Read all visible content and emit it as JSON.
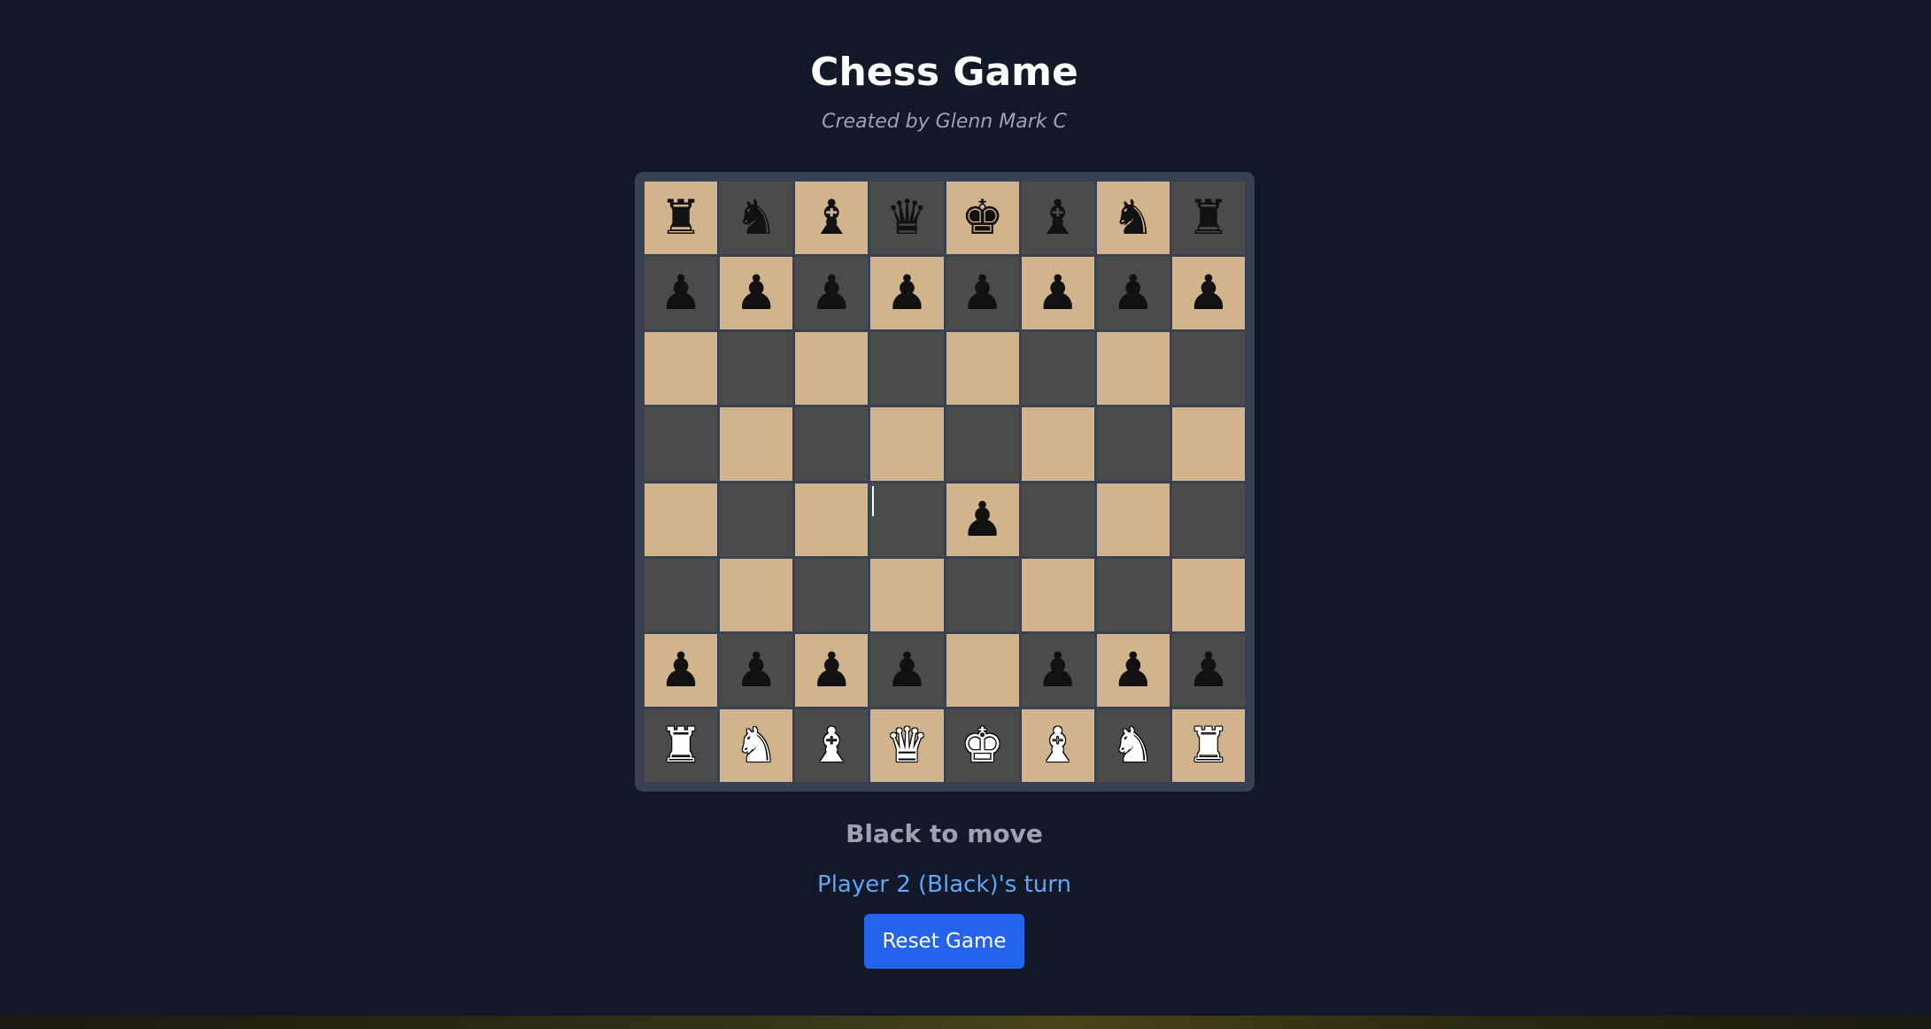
{
  "header": {
    "title": "Chess Game",
    "subtitle": "Created by Glenn Mark C"
  },
  "board": {
    "light_color": "#d2b48c",
    "dark_color": "#4b4b4b",
    "frame_color": "#374151",
    "rows": [
      [
        {
          "piece": "rook",
          "color": "black",
          "glyph": "♜"
        },
        {
          "piece": "knight",
          "color": "black",
          "glyph": "♞"
        },
        {
          "piece": "bishop",
          "color": "black",
          "glyph": "♝"
        },
        {
          "piece": "queen",
          "color": "black",
          "glyph": "♛"
        },
        {
          "piece": "king",
          "color": "black",
          "glyph": "♚"
        },
        {
          "piece": "bishop",
          "color": "black",
          "glyph": "♝"
        },
        {
          "piece": "knight",
          "color": "black",
          "glyph": "♞"
        },
        {
          "piece": "rook",
          "color": "black",
          "glyph": "♜"
        }
      ],
      [
        {
          "piece": "pawn",
          "color": "black",
          "glyph": "♟"
        },
        {
          "piece": "pawn",
          "color": "black",
          "glyph": "♟"
        },
        {
          "piece": "pawn",
          "color": "black",
          "glyph": "♟"
        },
        {
          "piece": "pawn",
          "color": "black",
          "glyph": "♟"
        },
        {
          "piece": "pawn",
          "color": "black",
          "glyph": "♟"
        },
        {
          "piece": "pawn",
          "color": "black",
          "glyph": "♟"
        },
        {
          "piece": "pawn",
          "color": "black",
          "glyph": "♟"
        },
        {
          "piece": "pawn",
          "color": "black",
          "glyph": "♟"
        }
      ],
      [
        null,
        null,
        null,
        null,
        null,
        null,
        null,
        null
      ],
      [
        null,
        null,
        null,
        null,
        null,
        null,
        null,
        null
      ],
      [
        null,
        null,
        null,
        null,
        {
          "piece": "pawn",
          "color": "black",
          "glyph": "♟"
        },
        null,
        null,
        null
      ],
      [
        null,
        null,
        null,
        null,
        null,
        null,
        null,
        null
      ],
      [
        {
          "piece": "pawn",
          "color": "black",
          "glyph": "♟"
        },
        {
          "piece": "pawn",
          "color": "black",
          "glyph": "♟"
        },
        {
          "piece": "pawn",
          "color": "black",
          "glyph": "♟"
        },
        {
          "piece": "pawn",
          "color": "black",
          "glyph": "♟"
        },
        null,
        {
          "piece": "pawn",
          "color": "black",
          "glyph": "♟"
        },
        {
          "piece": "pawn",
          "color": "black",
          "glyph": "♟"
        },
        {
          "piece": "pawn",
          "color": "black",
          "glyph": "♟"
        }
      ],
      [
        {
          "piece": "rook",
          "color": "white",
          "glyph": "♜"
        },
        {
          "piece": "knight",
          "color": "white",
          "glyph": "♞"
        },
        {
          "piece": "bishop",
          "color": "white",
          "glyph": "♝"
        },
        {
          "piece": "queen",
          "color": "white",
          "glyph": "♛"
        },
        {
          "piece": "king",
          "color": "white",
          "glyph": "♚"
        },
        {
          "piece": "bishop",
          "color": "white",
          "glyph": "♝"
        },
        {
          "piece": "knight",
          "color": "white",
          "glyph": "♞"
        },
        {
          "piece": "rook",
          "color": "white",
          "glyph": "♜"
        }
      ]
    ]
  },
  "status": {
    "move_text": "Black to move",
    "turn_text": "Player 2 (Black)'s turn"
  },
  "controls": {
    "reset_label": "Reset Game",
    "accent_color": "#2563eb"
  }
}
